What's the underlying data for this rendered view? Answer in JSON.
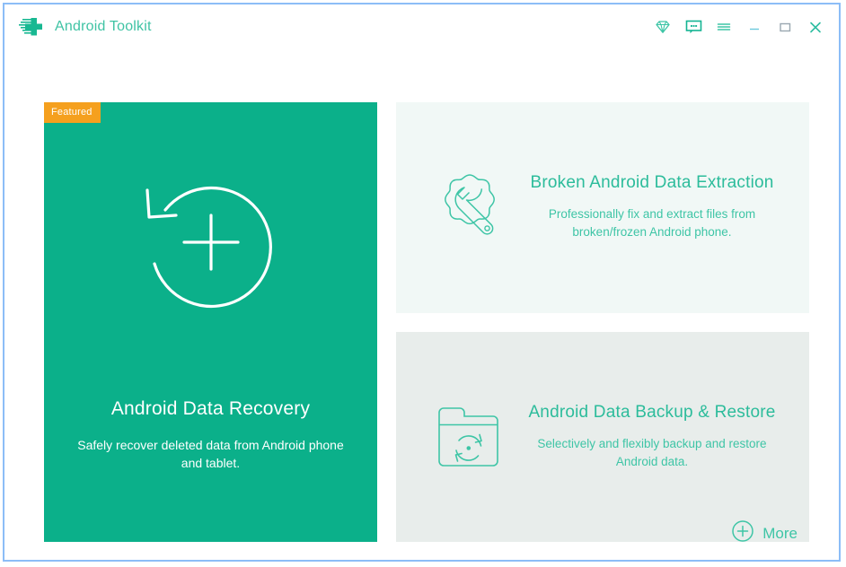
{
  "window": {
    "title": "Android Toolkit",
    "logo_icon": "android-cross-logo",
    "border_color": "#8cbdf7"
  },
  "titlebar": {
    "buttons": [
      {
        "name": "diamond-icon",
        "label": "Upgrade"
      },
      {
        "name": "chat-bubble-icon",
        "label": "Feedback"
      },
      {
        "name": "hamburger-menu-icon",
        "label": "Menu"
      },
      {
        "name": "minimize-icon",
        "label": "Minimize"
      },
      {
        "name": "maximize-icon",
        "label": "Maximize"
      },
      {
        "name": "close-icon",
        "label": "Close"
      }
    ]
  },
  "main": {
    "featured_card": {
      "badge": "Featured",
      "title": "Android Data Recovery",
      "description": "Safely recover deleted data from Android phone and tablet.",
      "icon": "circular-recovery-plus-icon",
      "background_color": "#0bb08a",
      "badge_color": "#f5a01e"
    },
    "cards": [
      {
        "title": "Broken Android Data Extraction",
        "description": "Professionally fix and extract files from broken/frozen Android phone.",
        "icon": "gear-wrench-icon",
        "background_color": "#f1f8f6",
        "accent_color": "#2cbc9b"
      },
      {
        "title": "Android Data Backup & Restore",
        "description": "Selectively and flexibly backup and restore Android data.",
        "icon": "folder-sync-icon",
        "background_color": "#e8edeb",
        "accent_color": "#2cbc9b"
      }
    ],
    "more": {
      "label": "More",
      "icon": "plus-circle-icon"
    }
  }
}
